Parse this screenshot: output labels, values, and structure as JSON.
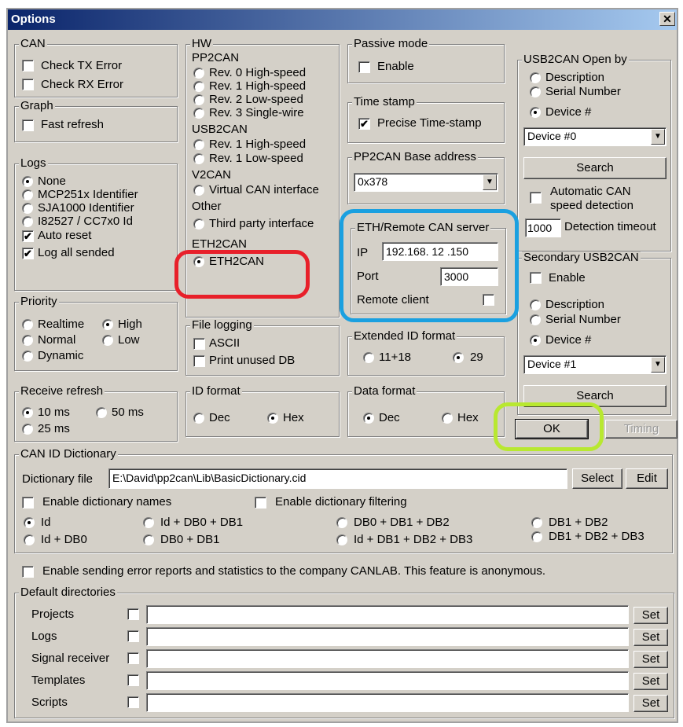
{
  "window": {
    "title": "Options",
    "close": "✕"
  },
  "can": {
    "title": "CAN",
    "check_tx": "Check TX Error",
    "check_rx": "Check RX Error"
  },
  "graph": {
    "title": "Graph",
    "fast_refresh": "Fast refresh"
  },
  "logs": {
    "title": "Logs",
    "options": [
      "None",
      "MCP251x Identifier",
      "SJA1000 Identifier",
      "I82527 / CC7x0 Id"
    ],
    "auto_reset": "Auto reset",
    "log_all": "Log all sended"
  },
  "priority": {
    "title": "Priority",
    "realtime": "Realtime",
    "high": "High",
    "normal": "Normal",
    "low": "Low",
    "dynamic": "Dynamic"
  },
  "receive_refresh": {
    "title": "Receive refresh",
    "ms10": "10 ms",
    "ms50": "50 ms",
    "ms25": "25 ms"
  },
  "hw": {
    "title": "HW",
    "pp2can": "PP2CAN",
    "rev0": "Rev. 0 High-speed",
    "rev1": "Rev. 1 High-speed",
    "rev2": "Rev. 2 Low-speed",
    "rev3": "Rev. 3 Single-wire",
    "usb2can": "USB2CAN",
    "usb_rev1h": "Rev. 1 High-speed",
    "usb_rev1l": "Rev. 1 Low-speed",
    "v2can": "V2CAN",
    "virtual": "Virtual CAN interface",
    "other": "Other",
    "third": "Third party interface",
    "eth2can_label": "ETH2CAN",
    "eth2can_option": "ETH2CAN"
  },
  "file_logging": {
    "title": "File logging",
    "ascii": "ASCII",
    "print_unused": "Print unused DB"
  },
  "id_format": {
    "title": "ID format",
    "dec": "Dec",
    "hex": "Hex"
  },
  "passive": {
    "title": "Passive mode",
    "enable": "Enable"
  },
  "timestamp": {
    "title": "Time stamp",
    "precise": "Precise Time-stamp"
  },
  "pp2can_base": {
    "title": "PP2CAN Base address",
    "value": "0x378"
  },
  "eth_remote": {
    "title": "ETH/Remote CAN server",
    "ip_label": "IP",
    "ip_value": "192.168. 12 .150",
    "port_label": "Port",
    "port_value": "3000",
    "remote_client": "Remote client"
  },
  "ext_id": {
    "title": "Extended ID format",
    "opt1": "11+18",
    "opt2": "29"
  },
  "data_format": {
    "title": "Data format",
    "dec": "Dec",
    "hex": "Hex"
  },
  "usb2can_open": {
    "title": "USB2CAN Open by",
    "description": "Description",
    "serial": "Serial Number",
    "device": "Device #",
    "device_value": "Device #0",
    "search": "Search",
    "auto_speed": "Automatic CAN",
    "auto_speed2": "speed detection",
    "timeout_value": "1000",
    "timeout_label": "Detection timeout"
  },
  "secondary": {
    "title": "Secondary USB2CAN",
    "enable": "Enable",
    "description": "Description",
    "serial": "Serial Number",
    "device": "Device #",
    "device_value": "Device #1",
    "search": "Search"
  },
  "buttons": {
    "ok": "OK",
    "timing": "Timing"
  },
  "dictionary": {
    "title": "CAN ID Dictionary",
    "file_label": "Dictionary file",
    "file_value": "E:\\David\\pp2can\\Lib\\BasicDictionary.cid",
    "select": "Select",
    "edit": "Edit",
    "enable_names": "Enable dictionary names",
    "enable_filtering": "Enable dictionary filtering",
    "opts": [
      "Id",
      "Id + DB0 + DB1",
      "DB0 + DB1 + DB2",
      "DB1 + DB2",
      "Id + DB0",
      "DB0 + DB1",
      "Id + DB1 + DB2 + DB3",
      "DB1 + DB2 + DB3"
    ]
  },
  "error_reports": "Enable sending error reports and statistics to the company CANLAB. This feature is anonymous.",
  "default_dirs": {
    "title": "Default directories",
    "rows": [
      "Projects",
      "Logs",
      "Signal receiver",
      "Templates",
      "Scripts"
    ],
    "set": "Set"
  },
  "colors": {
    "red_highlight": "#e8202a",
    "blue_highlight": "#1aa0e0",
    "green_highlight": "#b8e830"
  }
}
